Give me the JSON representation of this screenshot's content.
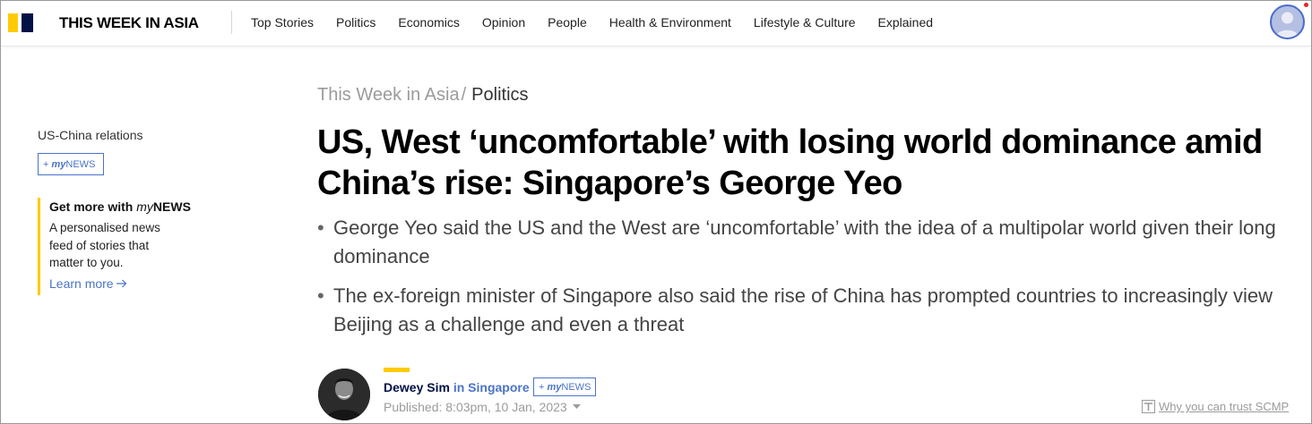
{
  "header": {
    "brand": "THIS WEEK IN ASIA",
    "nav": [
      "Top Stories",
      "Politics",
      "Economics",
      "Opinion",
      "People",
      "Health & Environment",
      "Lifestyle & Culture",
      "Explained"
    ]
  },
  "sidebar": {
    "topic": "US-China relations",
    "mynews_plus": "+",
    "mynews_my": "my",
    "mynews_news": "NEWS",
    "promo_title_prefix": "Get more with ",
    "promo_title_my": "my",
    "promo_title_news": "NEWS",
    "promo_body": "A personalised news feed of stories that matter to you.",
    "promo_link": "Learn more"
  },
  "article": {
    "breadcrumb_home": "This Week in Asia",
    "breadcrumb_sep": "/",
    "breadcrumb_section": "Politics",
    "headline": "US, West ‘uncomfortable’ with losing world dominance amid China’s rise: Singapore’s George Yeo",
    "summary": [
      "George Yeo said the US and the West are ‘uncomfortable’ with the idea of a multipolar world given their long dominance",
      "The ex-foreign minister of Singapore also said the rise of China has prompted countries to increasingly view Beijing as a challenge and even a threat"
    ],
    "bullet": "•"
  },
  "byline": {
    "author": "Dewey Sim",
    "location": " in Singapore",
    "mynews_plus": "+",
    "mynews_my": "my",
    "mynews_news": "NEWS",
    "published": "Published: 8:03pm, 10 Jan, 2023",
    "trust_link": "Why you can trust SCMP"
  },
  "colors": {
    "brand_yellow": "#ffca05",
    "brand_navy": "#001246",
    "link_blue": "#4a74c9"
  },
  "icons": [
    "logo-mark-icon",
    "user-avatar-icon",
    "arrow-right-icon",
    "chevron-down-icon",
    "trust-badge-icon"
  ]
}
